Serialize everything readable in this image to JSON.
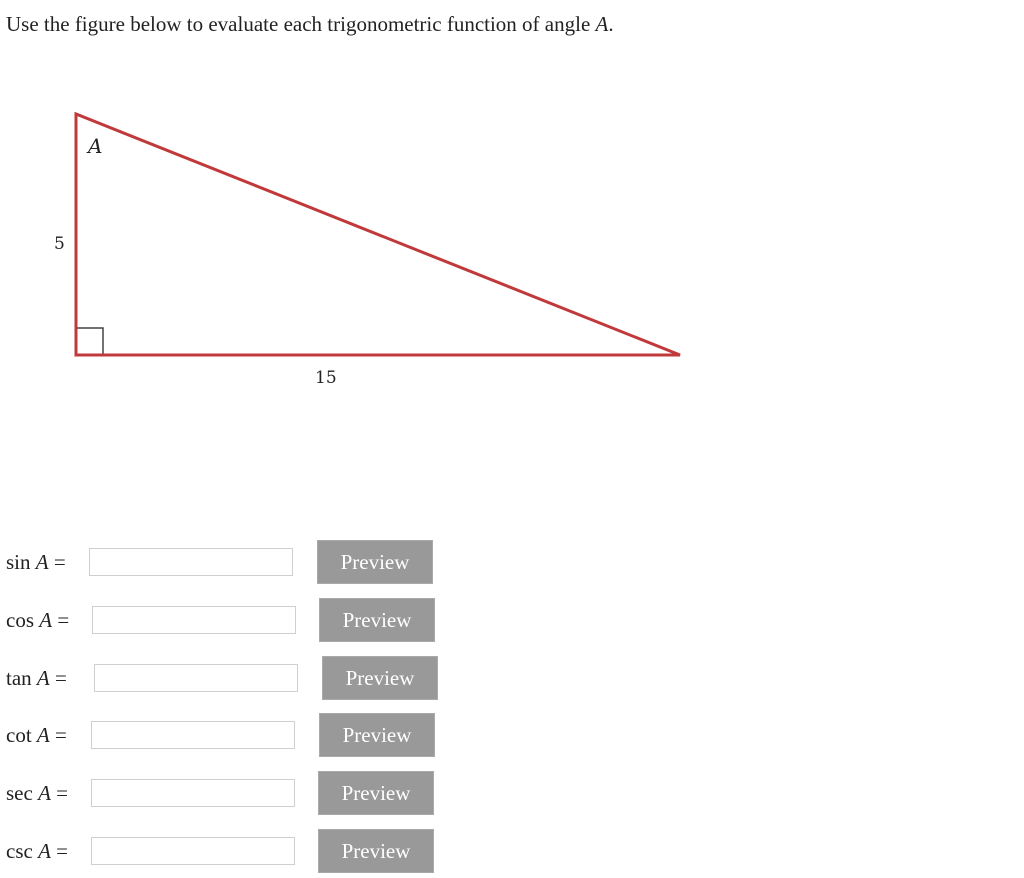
{
  "prompt": {
    "text": "Use the figure below to evaluate each trigonometric function of angle ",
    "angle_var": "A",
    "end": "."
  },
  "figure": {
    "angle_label": "A",
    "vertical_leg_label": "5",
    "horizontal_leg_label": "15",
    "stroke_color": "#c0393b",
    "right_angle_marker_color": "#444444"
  },
  "rows": [
    {
      "func": "sin",
      "var": "A",
      "equals": "=",
      "value": "",
      "placeholder": "",
      "button": "Preview"
    },
    {
      "func": "cos",
      "var": "A",
      "equals": "=",
      "value": "",
      "placeholder": "",
      "button": "Preview"
    },
    {
      "func": "tan",
      "var": "A",
      "equals": "=",
      "value": "",
      "placeholder": "",
      "button": "Preview"
    },
    {
      "func": "cot",
      "var": "A",
      "equals": "=",
      "value": "",
      "placeholder": "",
      "button": "Preview"
    },
    {
      "func": "sec",
      "var": "A",
      "equals": "=",
      "value": "",
      "placeholder": "",
      "button": "Preview"
    },
    {
      "func": "csc",
      "var": "A",
      "equals": "=",
      "value": "",
      "placeholder": "",
      "button": "Preview"
    }
  ],
  "colors": {
    "button_bg": "#999999",
    "button_text": "#ffffff",
    "input_border": "#cfcfcf"
  }
}
